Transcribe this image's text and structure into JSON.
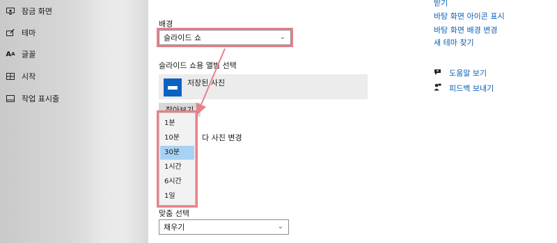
{
  "sidebar": {
    "items": [
      {
        "label": "잠금 화면",
        "icon": "monitor-lock-icon"
      },
      {
        "label": "테마",
        "icon": "brush-icon"
      },
      {
        "label": "글꼴",
        "icon": "font-icon"
      },
      {
        "label": "시작",
        "icon": "start-grid-icon"
      },
      {
        "label": "작업 표시줄",
        "icon": "taskbar-icon"
      }
    ]
  },
  "background": {
    "label": "배경",
    "value": "슬라이드 쇼"
  },
  "album": {
    "label": "슬라이드 쇼용 앨범 선택",
    "name": "저장된 사진"
  },
  "browse_label": "찾아보기",
  "change_label": "다 사진 변경",
  "interval_options": [
    "1분",
    "10분",
    "30분",
    "1시간",
    "6시간",
    "1일"
  ],
  "interval_selected": "30분",
  "fit": {
    "label": "맞춤 선택",
    "value": "채우기"
  },
  "related_links": [
    "받기",
    "바탕 화면 아이콘 표시",
    "바탕 화면 배경 변경",
    "새 테마 찾기"
  ],
  "help": {
    "get_help": "도움말 보기",
    "feedback": "피드백 보내기"
  },
  "colors": {
    "highlight": "#e8808a",
    "link": "#0a5fb8",
    "selected_item": "#a8d2f5"
  }
}
